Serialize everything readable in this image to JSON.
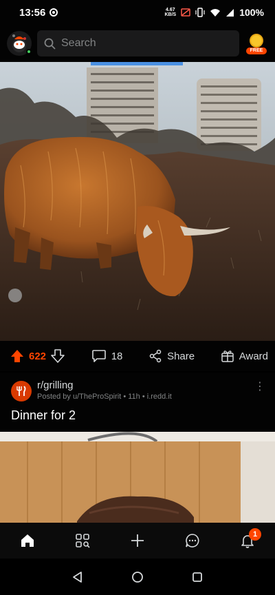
{
  "status_bar": {
    "time": "13:56",
    "speed_value": "4.67",
    "speed_unit": "KB/S",
    "battery": "100%"
  },
  "header": {
    "search_placeholder": "Search",
    "free_badge": "FREE"
  },
  "post1": {
    "image_subject": "highland cow grazing",
    "vote_count": "622",
    "comments_count": "18",
    "share_label": "Share",
    "award_label": "Award"
  },
  "post2": {
    "subreddit": "r/grilling",
    "meta": "Posted by u/TheProSpirit • 11h • i.redd.it",
    "title": "Dinner for 2"
  },
  "bottom_nav": {
    "items": [
      "home-icon",
      "discover-icon",
      "create-icon",
      "chat-icon",
      "notifications-icon"
    ],
    "notification_count": "1"
  },
  "colors": {
    "accent": "#ff4500",
    "background": "#030303",
    "text": "#d7dadc",
    "muted": "#818384"
  }
}
